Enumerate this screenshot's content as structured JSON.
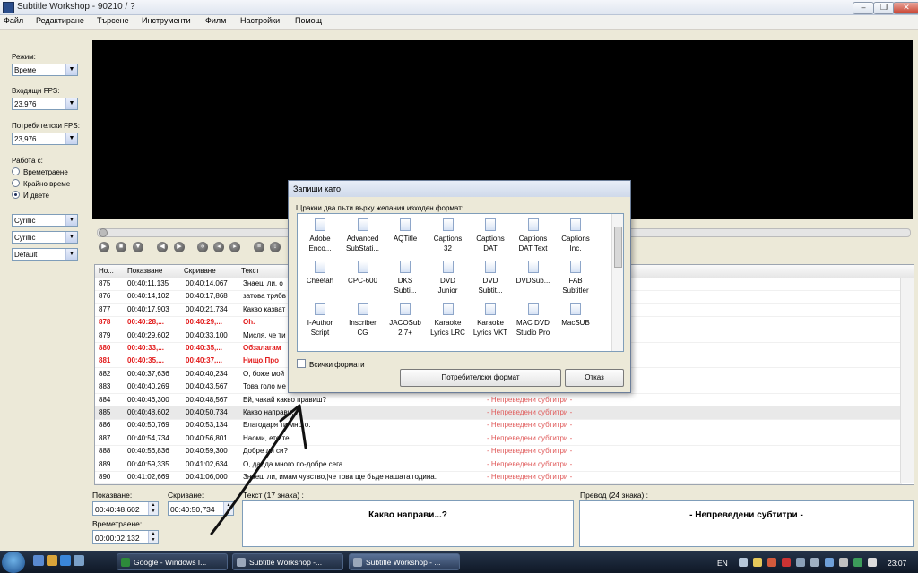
{
  "window": {
    "title": "Subtitle Workshop - 90210 / ?"
  },
  "menu": [
    "Файл",
    "Редактиране",
    "Търсене",
    "Инструменти",
    "Филм",
    "Настройки",
    "Помощ"
  ],
  "left_panel": {
    "mode_label": "Режим:",
    "mode_value": "Време",
    "input_fps_label": "Входящи FPS:",
    "input_fps_value": "23,976",
    "user_fps_label": "Потребителски FPS:",
    "user_fps_value": "23,976",
    "work_with_label": "Работа с:",
    "radio": [
      "Времетраене",
      "Крайно време",
      "И двете"
    ],
    "radio_selected": 2,
    "charset1": "Cyrillic",
    "charset2": "Cyrillic",
    "charset3": "Default"
  },
  "grid": {
    "headers": [
      "Но...",
      "Показване",
      "Скриване",
      "Текст"
    ],
    "rows": [
      {
        "n": "875",
        "show": "00:40:11,135",
        "hide": "00:40:14,067",
        "text": "Знаеш ли, о",
        "trans": "",
        "style": ""
      },
      {
        "n": "876",
        "show": "00:40:14,102",
        "hide": "00:40:17,868",
        "text": "затова трябв",
        "trans": "",
        "style": ""
      },
      {
        "n": "877",
        "show": "00:40:17,903",
        "hide": "00:40:21,734",
        "text": "Какво казват",
        "trans": "",
        "style": ""
      },
      {
        "n": "878",
        "show": "00:40:28,...",
        "hide": "00:40:29,...",
        "text": "Oh.",
        "trans": "",
        "style": "red"
      },
      {
        "n": "879",
        "show": "00:40:29,602",
        "hide": "00:40:33,100",
        "text": "Мисля, че ти",
        "trans": "",
        "style": ""
      },
      {
        "n": "880",
        "show": "00:40:33,...",
        "hide": "00:40:35,...",
        "text": "Обзалагам",
        "trans": "",
        "style": "red"
      },
      {
        "n": "881",
        "show": "00:40:35,...",
        "hide": "00:40:37,...",
        "text": "Нищо.Про",
        "trans": "",
        "style": "red"
      },
      {
        "n": "882",
        "show": "00:40:37,636",
        "hide": "00:40:40,234",
        "text": "О, боже мой",
        "trans": "",
        "style": ""
      },
      {
        "n": "883",
        "show": "00:40:40,269",
        "hide": "00:40:43,567",
        "text": "Това голо ме",
        "trans": "",
        "style": ""
      },
      {
        "n": "884",
        "show": "00:40:46,300",
        "hide": "00:40:48,567",
        "text": "Ей, чакай какво правиш?",
        "trans": "- Непреведени субтитри -",
        "style": ""
      },
      {
        "n": "885",
        "show": "00:40:48,602",
        "hide": "00:40:50,734",
        "text": "Какво направи...?",
        "trans": "- Непреведени субтитри -",
        "style": "sel"
      },
      {
        "n": "886",
        "show": "00:40:50,769",
        "hide": "00:40:53,134",
        "text": "Благодаря ти много.",
        "trans": "- Непреведени субтитри -",
        "style": ""
      },
      {
        "n": "887",
        "show": "00:40:54,734",
        "hide": "00:40:56,801",
        "text": "Наоми, ето те.",
        "trans": "- Непреведени субтитри -",
        "style": ""
      },
      {
        "n": "888",
        "show": "00:40:56,836",
        "hide": "00:40:59,300",
        "text": "Добре ли си?",
        "trans": "- Непреведени субтитри -",
        "style": ""
      },
      {
        "n": "889",
        "show": "00:40:59,335",
        "hide": "00:41:02,634",
        "text": "О, да, да много по-добре сега.",
        "trans": "- Непреведени субтитри -",
        "style": ""
      },
      {
        "n": "890",
        "show": "00:41:02,669",
        "hide": "00:41:06,000",
        "text": "Знаеш ли, имам чувство,|че това ще бъде нашата година.",
        "trans": "- Непреведени субтитри -",
        "style": ""
      }
    ]
  },
  "edit": {
    "show_label": "Показване:",
    "show_value": "00:40:48,602",
    "hide_label": "Скриване:",
    "hide_value": "00:40:50,734",
    "duration_label": "Времетраене:",
    "duration_value": "00:00:02,132",
    "text_label": "Текст  (17 знака)  :",
    "text_value": "Какво направи...?",
    "trans_label": "Превод  (24 знака)  :",
    "trans_value": "- Непреведени субтитри -"
  },
  "dialog": {
    "title": "Запиши като",
    "hint": "Щракни два пъти върху желания изходен формат:",
    "formats": [
      [
        "Adobe",
        "Enco..."
      ],
      [
        "Advanced",
        "SubStati..."
      ],
      [
        "AQTitle",
        ""
      ],
      [
        "Captions",
        "32"
      ],
      [
        "Captions",
        "DAT"
      ],
      [
        "Captions",
        "DAT Text"
      ],
      [
        "Captions",
        "Inc."
      ],
      [
        "Cheetah",
        ""
      ],
      [
        "CPC-600",
        ""
      ],
      [
        "DKS",
        "Subti..."
      ],
      [
        "DVD",
        "Junior"
      ],
      [
        "DVD",
        "Subtit..."
      ],
      [
        "DVDSub...",
        ""
      ],
      [
        "FAB",
        "Subtitler"
      ],
      [
        "I-Author",
        "Script"
      ],
      [
        "Inscriber",
        "CG"
      ],
      [
        "JACOSub",
        "2.7+"
      ],
      [
        "Karaoke",
        "Lyrics LRC"
      ],
      [
        "Karaoke",
        "Lyrics VKT"
      ],
      [
        "MAC DVD",
        "Studio Pro"
      ],
      [
        "MacSUB",
        ""
      ]
    ],
    "all_formats": "Всички формати",
    "custom_button": "Потребителски формат",
    "cancel_button": "Отказ"
  },
  "taskbar": {
    "tasks": [
      "Google - Windows I...",
      "Subtitle Workshop -...",
      "Subtitle Workshop - ..."
    ],
    "lang": "EN",
    "clock": "23:07"
  }
}
